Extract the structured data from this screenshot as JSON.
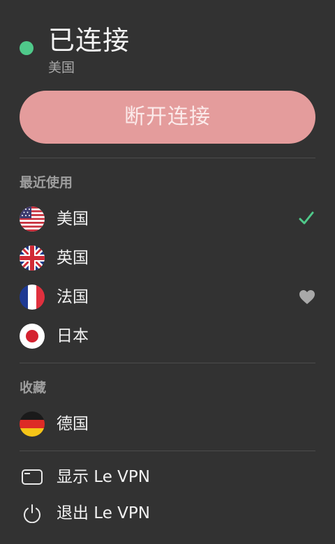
{
  "status": {
    "title": "已连接",
    "location": "美国",
    "dot_color": "#4fc98a"
  },
  "disconnect_button": {
    "label": "断开连接",
    "color": "#e49c9c"
  },
  "recent": {
    "section_title": "最近使用",
    "items": [
      {
        "label": "美国",
        "flag": "us-flag-icon",
        "selected": true,
        "trailing_icon": "check-icon"
      },
      {
        "label": "英国",
        "flag": "uk-flag-icon",
        "selected": false
      },
      {
        "label": "法国",
        "flag": "france-flag-icon",
        "selected": false,
        "trailing_icon": "heart-icon"
      },
      {
        "label": "日本",
        "flag": "japan-flag-icon",
        "selected": false
      }
    ]
  },
  "favorites": {
    "section_title": "收藏",
    "items": [
      {
        "label": "德国",
        "flag": "germany-flag-icon"
      }
    ]
  },
  "menu": {
    "show_app": {
      "label": "显示 Le VPN",
      "icon": "window-icon"
    },
    "quit_app": {
      "label": "退出 Le VPN",
      "icon": "power-icon"
    }
  },
  "colors": {
    "background": "#323232",
    "accent_green": "#4fc98a",
    "secondary_text": "#9e9e9e"
  }
}
